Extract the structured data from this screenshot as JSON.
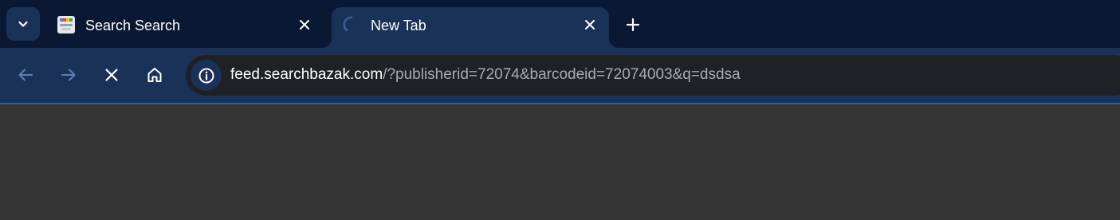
{
  "tabs": [
    {
      "title": "Search Search",
      "active": false,
      "favicon": "google-search-favicon",
      "close_icon": "close-icon"
    },
    {
      "title": "New Tab",
      "active": true,
      "favicon": "loading-spinner-icon",
      "close_icon": "close-icon"
    }
  ],
  "toolbar": {
    "back_icon": "arrow-left-icon",
    "forward_icon": "arrow-right-icon",
    "stop_icon": "close-icon",
    "home_icon": "home-icon",
    "new_tab_icon": "plus-icon",
    "tab_search_icon": "chevron-down-icon"
  },
  "omnibox": {
    "site_info_icon": "info-icon",
    "host": "feed.searchbazak.com",
    "path": "/?publisherid=72074&barcodeid=72074003&q=dsdsa"
  },
  "colors": {
    "tabstrip_bg": "#0b1833",
    "toolbar_bg": "#1b3258",
    "omnibox_bg": "#1f2124",
    "content_bg": "#343434",
    "url_host": "#ffffff",
    "url_path": "#a8abb0"
  }
}
